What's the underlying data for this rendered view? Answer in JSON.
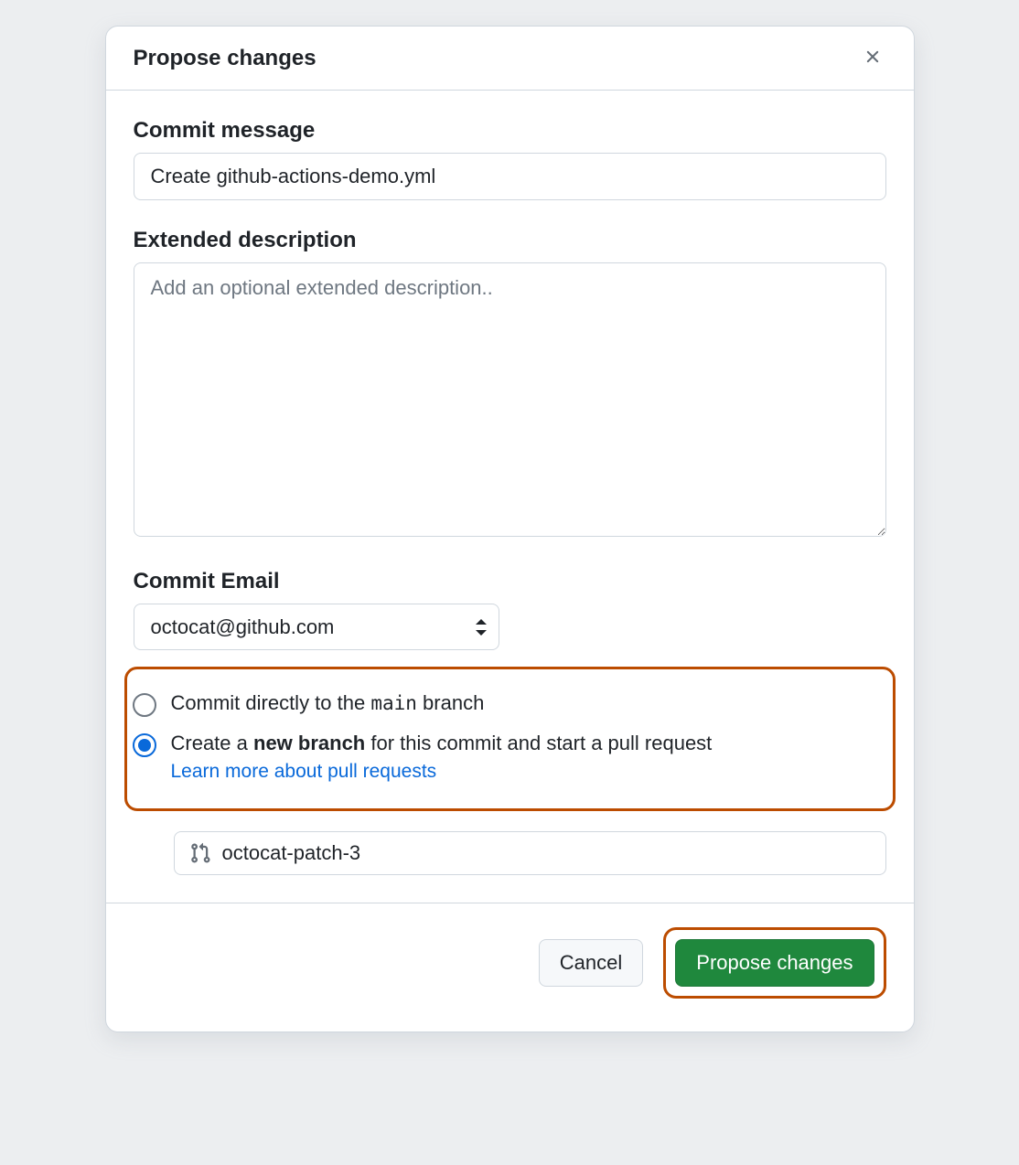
{
  "dialog": {
    "title": "Propose changes",
    "commit_message": {
      "label": "Commit message",
      "value": "Create github-actions-demo.yml"
    },
    "extended_description": {
      "label": "Extended description",
      "placeholder": "Add an optional extended description.."
    },
    "commit_email": {
      "label": "Commit Email",
      "value": "octocat@github.com"
    },
    "radio": {
      "direct_prefix": "Commit directly to the ",
      "direct_branch": "main",
      "direct_suffix": " branch",
      "new_prefix": "Create a ",
      "new_bold": "new branch",
      "new_suffix": " for this commit and start a pull request",
      "learn_link": "Learn more about pull requests"
    },
    "branch_input": {
      "value": "octocat-patch-3"
    },
    "footer": {
      "cancel": "Cancel",
      "propose": "Propose changes"
    }
  }
}
